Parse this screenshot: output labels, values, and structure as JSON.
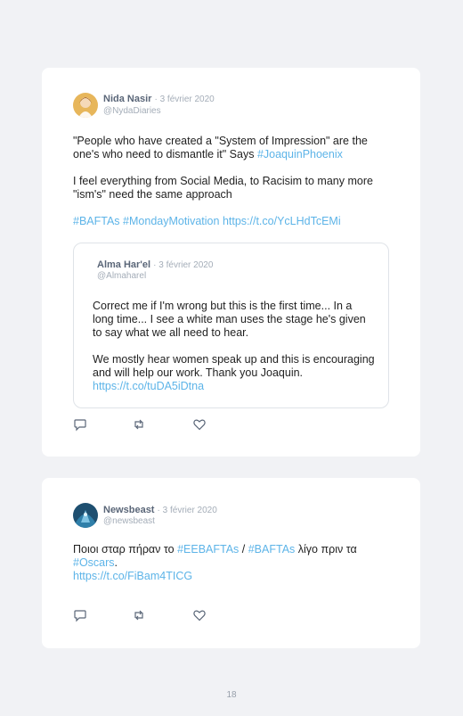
{
  "tweets": [
    {
      "author": "Nida Nasir",
      "date": "· 3 février 2020",
      "handle": "@NydaDiaries",
      "p1_before": "\"People who have created a \"System of Impression\" are the one's who need to dismantle it\" Says ",
      "p1_tag": "#JoaquinPhoenix",
      "p2": "I feel everything from Social Media, to Racisim to many more \"ism's\" need the same approach",
      "p3_tag1": "#BAFTAs",
      "p3_tag2": "#MondayMotivation",
      "p3_link": "https://t.co/YcLHdTcEMi",
      "quote": {
        "author": "Alma Har'el",
        "date": "· 3 février 2020",
        "handle": "@Almaharel",
        "p1": "Correct me if I'm wrong but this is the first time... In a long time... I see a white man uses the stage he's given to say what we all need to hear.",
        "p2_before": "We mostly hear women speak up and this is encouraging and will help our work. Thank you Joaquin. ",
        "p2_link": "https://t.co/tuDA5iDtna"
      }
    },
    {
      "author": "Newsbeast",
      "date": "· 3 février 2020",
      "handle": "@newsbeast",
      "t_before": "Ποιοι σταρ πήραν το ",
      "t_tag1": "#EEBAFTAs",
      "t_sep": " / ",
      "t_tag2": "#BAFTAs",
      "t_mid": " λίγο πριν τα ",
      "t_tag3": "#Oscars",
      "t_dot": ".",
      "t_link": "https://t.co/FiBam4TICG"
    }
  ],
  "page_number": "18",
  "colors": {
    "link": "#5db4e8",
    "background": "#f1f2f5",
    "card": "#ffffff"
  }
}
